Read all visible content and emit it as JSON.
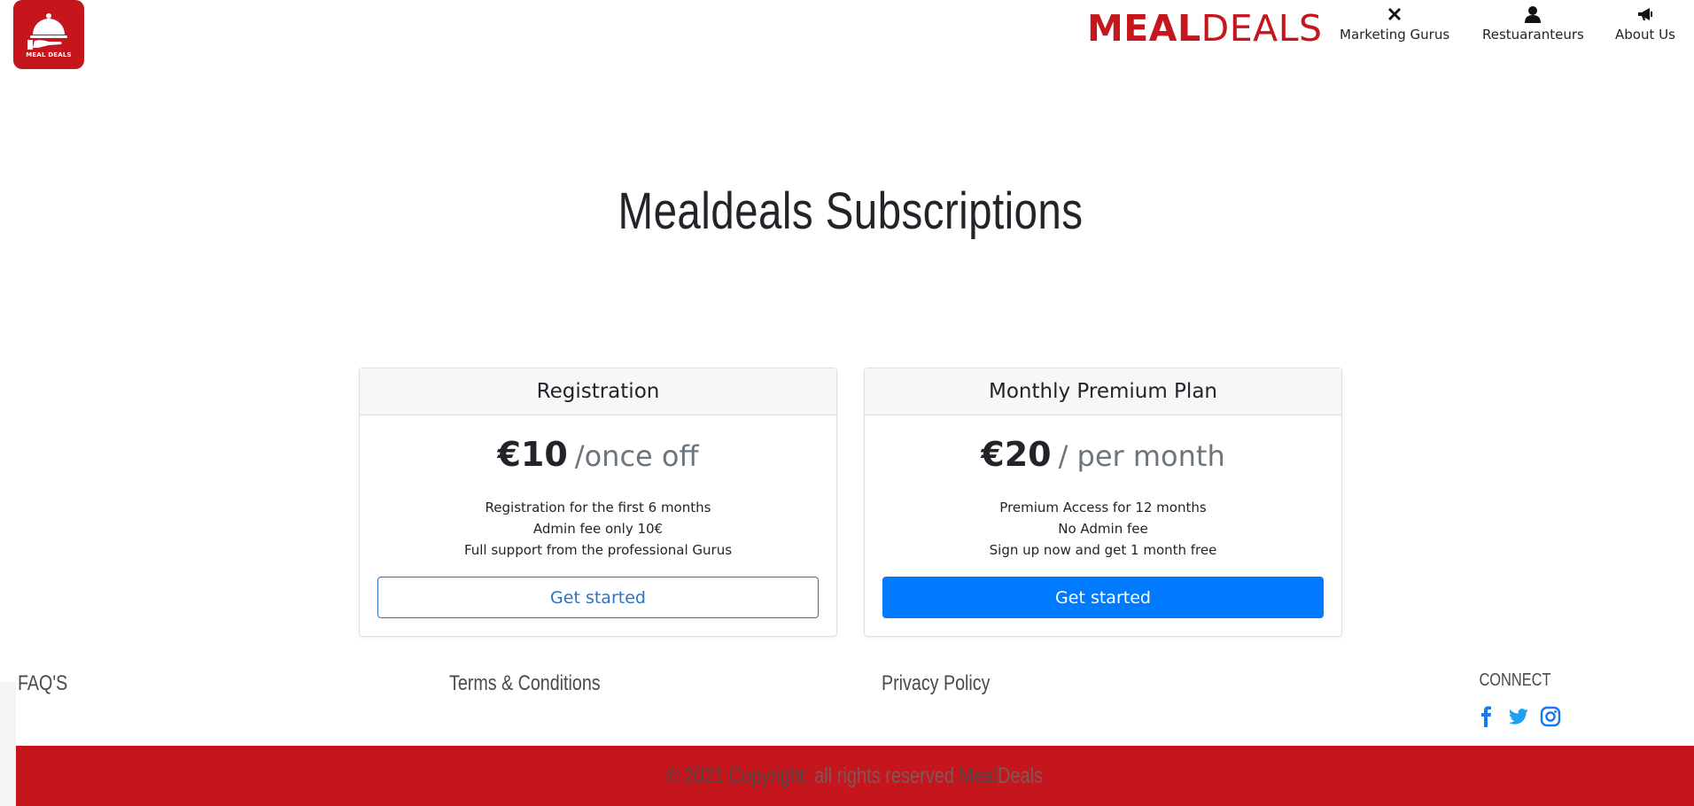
{
  "logo": {
    "text": "MEAL DEALS"
  },
  "brand": {
    "part1": "MEAL",
    "part2": "DEALS"
  },
  "nav": [
    {
      "label": "Marketing Gurus",
      "icon": "tools-icon"
    },
    {
      "label": "Restuaranteurs",
      "icon": "user-icon"
    },
    {
      "label": "About Us",
      "icon": "megaphone-icon"
    }
  ],
  "page": {
    "title": "Mealdeals Subscriptions"
  },
  "plans": [
    {
      "name": "Registration",
      "price": "€10",
      "period": "/once off",
      "features": [
        "Registration for the first 6 months",
        "Admin fee only 10€",
        "Full support from the professional Gurus"
      ],
      "button": "Get started"
    },
    {
      "name": "Monthly Premium Plan",
      "price": "€20",
      "period": "/ per month",
      "features": [
        "Premium Access for 12 months",
        "No Admin fee",
        "Sign up now and get 1 month free"
      ],
      "button": "Get started"
    }
  ],
  "footer": {
    "links": [
      "FAQ'S",
      "Terms & Conditions",
      "Privacy Policy"
    ],
    "connect_title": "CONNECT",
    "social": [
      "facebook-icon",
      "twitter-icon",
      "instagram-icon"
    ],
    "copyright_prefix": "© 2021 Copyright:",
    "copyright_rights": "all rights reserved",
    "copyright_brand1": "Meal",
    "copyright_brand2": "Deals"
  },
  "colors": {
    "brand_red": "#c4161c",
    "primary_blue": "#007bff",
    "outline_blue": "#2874c8"
  }
}
